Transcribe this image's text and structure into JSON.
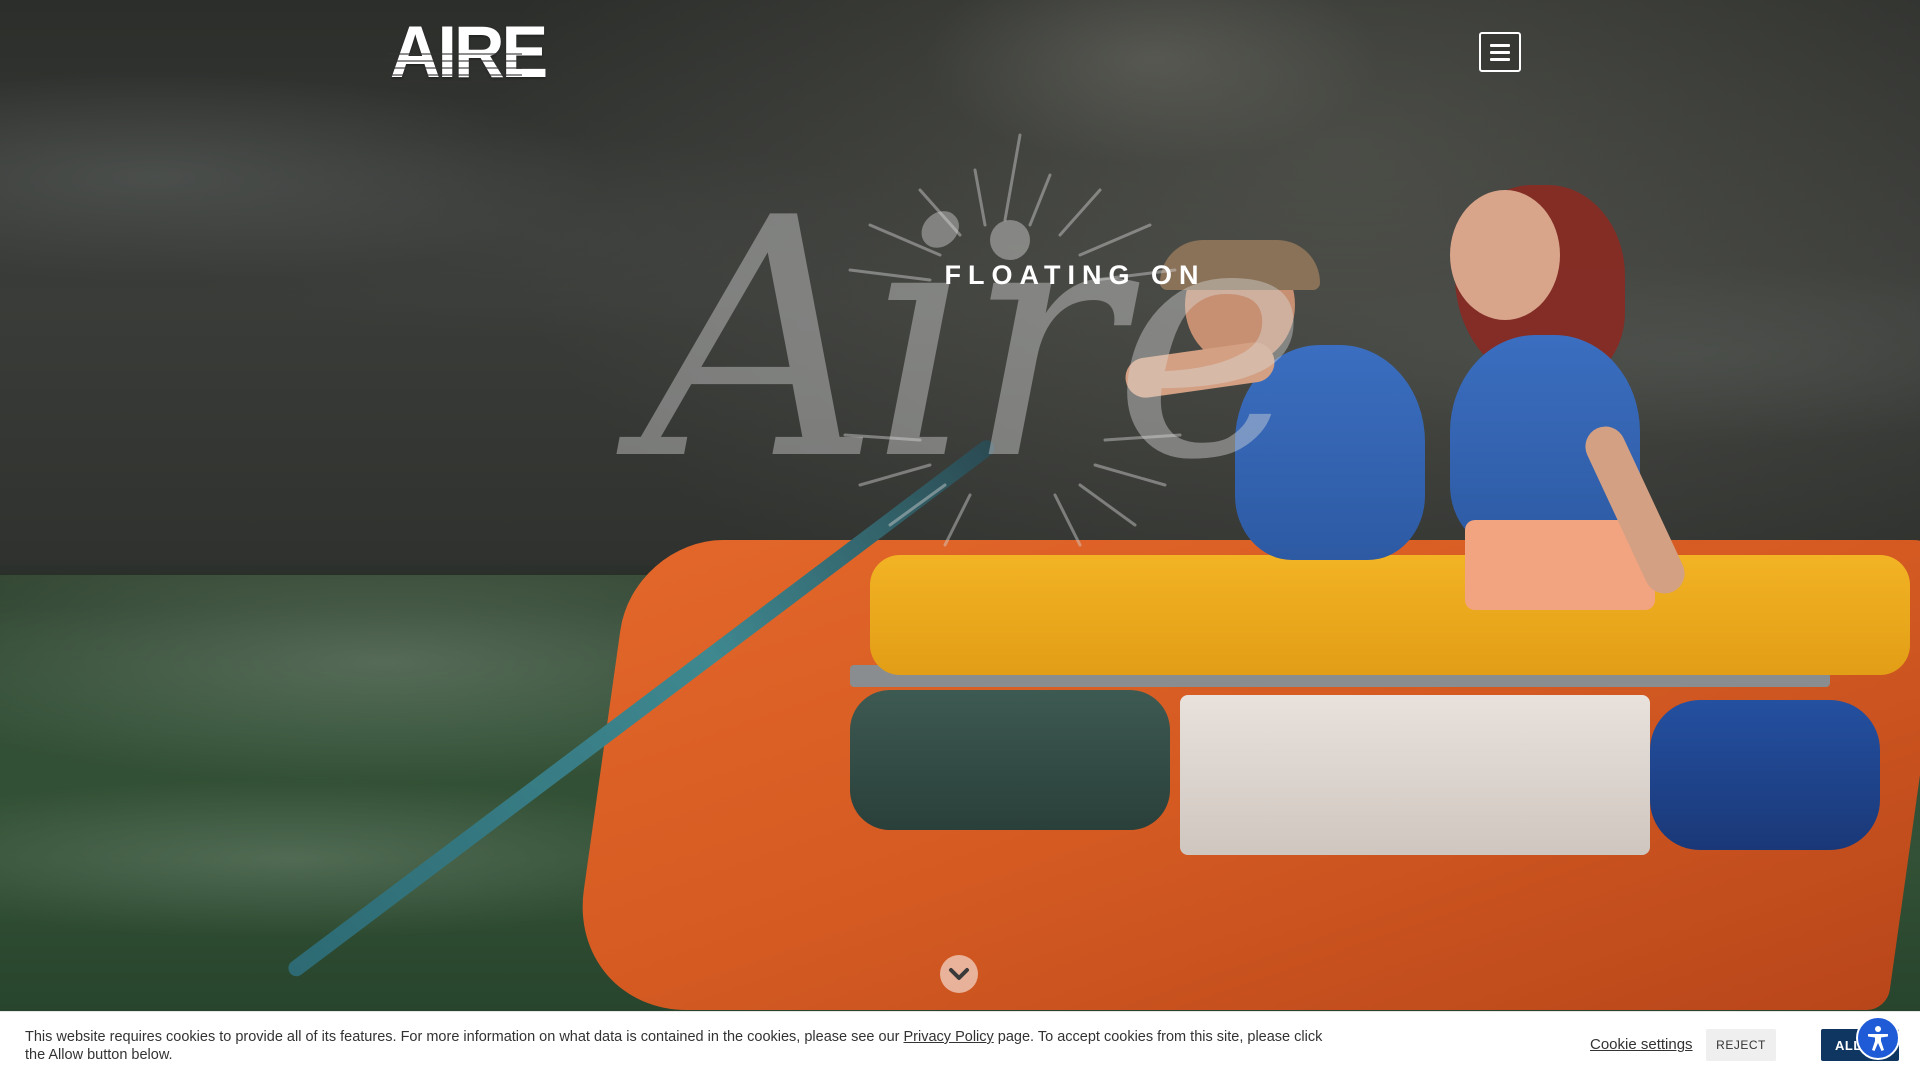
{
  "header": {
    "logo_text": "AIRE",
    "menu_icon": "hamburger-menu-icon"
  },
  "hero": {
    "title_small": "FLOATING ON",
    "title_script": "Aire",
    "scroll_icon": "chevron-down-icon"
  },
  "cookie_banner": {
    "text_before_link": "This website requires cookies to provide all of its features. For more information on what data is contained in the cookies, please see our ",
    "link_text": "Privacy Policy",
    "text_after_link": " page. To accept cookies from this site, please click the Allow button below.",
    "settings_label": "Cookie settings",
    "reject_label": "REJECT",
    "allow_label": "ALLOW",
    "accessibility_icon": "accessibility-icon"
  },
  "colors": {
    "allow_button": "#0f3561",
    "accessibility_button": "#1f5bd6"
  }
}
